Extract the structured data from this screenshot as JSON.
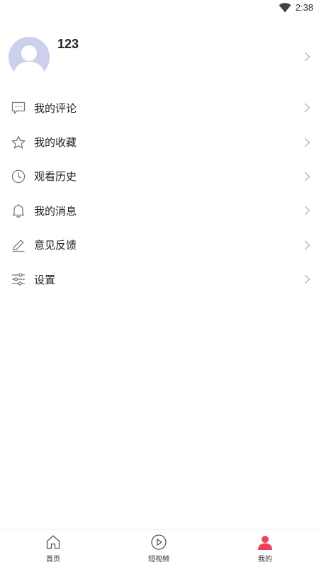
{
  "status_bar": {
    "time": "2:38",
    "wifi_icon": "wifi-icon"
  },
  "profile": {
    "username": "123",
    "avatar_icon": "default-avatar-icon"
  },
  "menu": {
    "items": [
      {
        "label": "我的评论",
        "icon": "comment-icon"
      },
      {
        "label": "我的收藏",
        "icon": "star-icon"
      },
      {
        "label": "观看历史",
        "icon": "clock-icon"
      },
      {
        "label": "我的消息",
        "icon": "bell-icon"
      },
      {
        "label": "意见反馈",
        "icon": "pencil-icon"
      },
      {
        "label": "设置",
        "icon": "sliders-icon"
      }
    ]
  },
  "bottom_nav": {
    "items": [
      {
        "label": "首页",
        "icon": "home-icon",
        "active": false
      },
      {
        "label": "短视频",
        "icon": "play-circle-icon",
        "active": false
      },
      {
        "label": "我的",
        "icon": "user-icon",
        "active": true
      }
    ]
  },
  "colors": {
    "accent": "#f0415a",
    "icon_gray": "#777777",
    "chevron_gray": "#b5b5b5",
    "avatar_bg": "#cfd1ea"
  }
}
